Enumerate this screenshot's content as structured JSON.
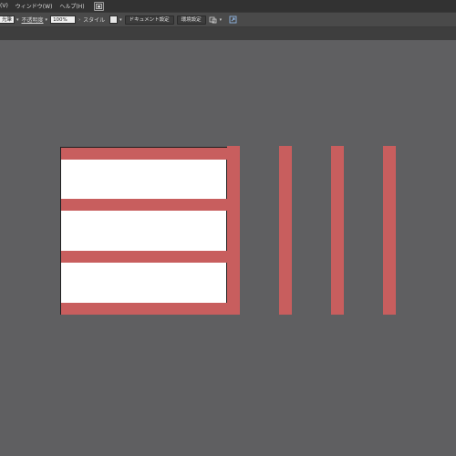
{
  "menubar": {
    "items": [
      "(V)",
      "ウィンドウ(W)",
      "ヘルプ(H)"
    ],
    "icon": "arrange-documents-icon"
  },
  "controlbar": {
    "stroke_value": "光筆",
    "opacity_label": "不透明度",
    "opacity_value": "100%",
    "style_label": "スタイル",
    "doc_settings_button": "ドキュメント設定",
    "preferences_button": "環境設定",
    "icons": [
      "transform-icon",
      "chevron-down-icon",
      "export-icon"
    ]
  },
  "colors": {
    "canvas": "#5f5f61",
    "artboard": "#ffffff",
    "stripe": "#c85e5e"
  },
  "artwork": {
    "horizontal_stripes": 4,
    "vertical_stripes": 4
  }
}
